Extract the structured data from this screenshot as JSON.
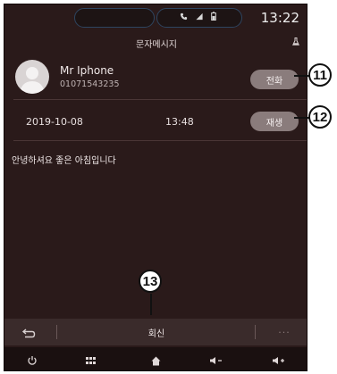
{
  "status_bar": {
    "time": "13:22",
    "icons": [
      "phone-icon",
      "signal-icon",
      "battery-icon"
    ]
  },
  "header": {
    "title": "문자메시지",
    "corner_icon": "flask-icon"
  },
  "contact": {
    "name": "Mr Iphone",
    "number": "01071543235",
    "avatar_icon": "person-icon"
  },
  "message": {
    "date": "2019-10-08",
    "time": "13:48",
    "body": "안녕하셔요 좋은 아침입니다"
  },
  "buttons": {
    "call": "전화",
    "play": "재생",
    "reply": "회신",
    "more": "···"
  },
  "nav": {
    "items": [
      "power-icon",
      "grid-icon",
      "home-icon",
      "volume-down-icon",
      "volume-up-icon"
    ]
  },
  "callouts": {
    "c11": "11",
    "c12": "12",
    "c13": "13"
  },
  "colors": {
    "background": "#2a1a1a",
    "button": "#8a7c7c",
    "accent_outline": "#2e4560"
  }
}
